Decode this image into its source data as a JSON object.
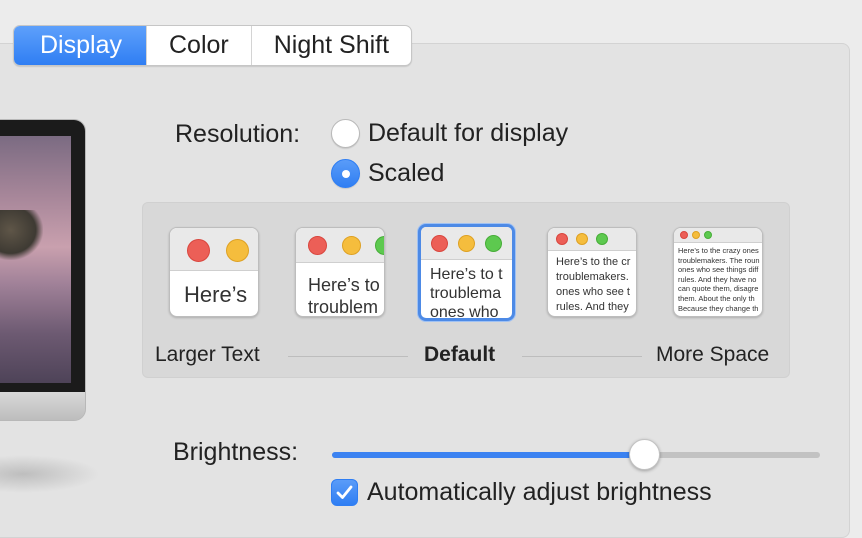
{
  "tabs": [
    {
      "label": "Display",
      "active": true
    },
    {
      "label": "Color",
      "active": false
    },
    {
      "label": "Night Shift",
      "active": false
    }
  ],
  "resolution": {
    "label": "Resolution:",
    "options": [
      {
        "label": "Default for display",
        "selected": false
      },
      {
        "label": "Scaled",
        "selected": true
      }
    ]
  },
  "scaling": {
    "left_label": "Larger Text",
    "center_label": "Default",
    "right_label": "More Space",
    "selected_index": 2,
    "previews": [
      {
        "text": "Here’s"
      },
      {
        "text": "Here’s to\ntroublem"
      },
      {
        "text": "Here’s to t\ntroublema\nones who"
      },
      {
        "text": "Here’s to the cr\ntroublemakers.\nones who see t\nrules. And they"
      },
      {
        "text": "Here’s to the crazy ones\ntroublemakers. The roun\nones who see things diff\nrules. And they have no\ncan quote them, disagre\nthem. About the only th\nBecause they change th"
      }
    ]
  },
  "brightness": {
    "label": "Brightness:",
    "value": 0.64,
    "auto_label": "Automatically adjust brightness",
    "auto_checked": true
  },
  "colors": {
    "accent": "#3b82f1",
    "traffic_red": "#ec5f57",
    "traffic_yellow": "#f5bd3d",
    "traffic_green": "#5dc94f"
  }
}
